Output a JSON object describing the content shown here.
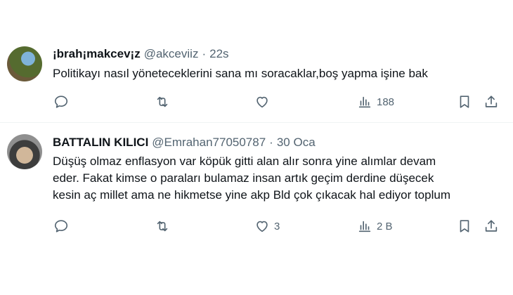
{
  "tweets": [
    {
      "name": "¡brah¡makcev¡z",
      "handle": "@akceviiz",
      "separator": "·",
      "time": "22s",
      "lines": [
        "Politikayı nasıl yöneteceklerini sana mı soracaklar,boş yapma işine bak"
      ],
      "stats": {
        "replies": "",
        "retweets": "",
        "likes": "",
        "views": "188"
      }
    },
    {
      "name": "BATTALIN KILICI",
      "handle": "@Emrahan77050787",
      "separator": "·",
      "time": "30 Oca",
      "lines": [
        "Düşüş olmaz enflasyon var köpük gitti alan alır sonra yine alımlar devam",
        "eder. Fakat kimse o paraları bulamaz insan artık geçim derdine düşecek",
        "kesin aç millet ama ne hikmetse yine akp Bld çok çıkacak hal ediyor toplum"
      ],
      "stats": {
        "replies": "",
        "retweets": "",
        "likes": "3",
        "views": "2 B"
      }
    }
  ],
  "icons": {
    "reply": "reply-icon",
    "retweet": "retweet-icon",
    "like": "heart-icon",
    "views": "views-icon",
    "bookmark": "bookmark-icon",
    "share": "share-icon"
  },
  "colors": {
    "text": "#0f1419",
    "muted": "#536471",
    "divider": "#eff3f4"
  }
}
